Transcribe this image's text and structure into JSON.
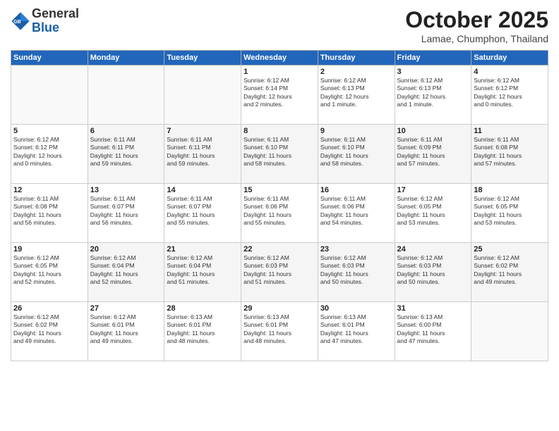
{
  "header": {
    "logo_general": "General",
    "logo_blue": "Blue",
    "month": "October 2025",
    "location": "Lamae, Chumphon, Thailand"
  },
  "weekdays": [
    "Sunday",
    "Monday",
    "Tuesday",
    "Wednesday",
    "Thursday",
    "Friday",
    "Saturday"
  ],
  "weeks": [
    [
      {
        "day": "",
        "info": ""
      },
      {
        "day": "",
        "info": ""
      },
      {
        "day": "",
        "info": ""
      },
      {
        "day": "1",
        "info": "Sunrise: 6:12 AM\nSunset: 6:14 PM\nDaylight: 12 hours\nand 2 minutes."
      },
      {
        "day": "2",
        "info": "Sunrise: 6:12 AM\nSunset: 6:13 PM\nDaylight: 12 hours\nand 1 minute."
      },
      {
        "day": "3",
        "info": "Sunrise: 6:12 AM\nSunset: 6:13 PM\nDaylight: 12 hours\nand 1 minute."
      },
      {
        "day": "4",
        "info": "Sunrise: 6:12 AM\nSunset: 6:12 PM\nDaylight: 12 hours\nand 0 minutes."
      }
    ],
    [
      {
        "day": "5",
        "info": "Sunrise: 6:12 AM\nSunset: 6:12 PM\nDaylight: 12 hours\nand 0 minutes."
      },
      {
        "day": "6",
        "info": "Sunrise: 6:11 AM\nSunset: 6:11 PM\nDaylight: 11 hours\nand 59 minutes."
      },
      {
        "day": "7",
        "info": "Sunrise: 6:11 AM\nSunset: 6:11 PM\nDaylight: 11 hours\nand 59 minutes."
      },
      {
        "day": "8",
        "info": "Sunrise: 6:11 AM\nSunset: 6:10 PM\nDaylight: 11 hours\nand 58 minutes."
      },
      {
        "day": "9",
        "info": "Sunrise: 6:11 AM\nSunset: 6:10 PM\nDaylight: 11 hours\nand 58 minutes."
      },
      {
        "day": "10",
        "info": "Sunrise: 6:11 AM\nSunset: 6:09 PM\nDaylight: 11 hours\nand 57 minutes."
      },
      {
        "day": "11",
        "info": "Sunrise: 6:11 AM\nSunset: 6:08 PM\nDaylight: 11 hours\nand 57 minutes."
      }
    ],
    [
      {
        "day": "12",
        "info": "Sunrise: 6:11 AM\nSunset: 6:08 PM\nDaylight: 11 hours\nand 56 minutes."
      },
      {
        "day": "13",
        "info": "Sunrise: 6:11 AM\nSunset: 6:07 PM\nDaylight: 11 hours\nand 56 minutes."
      },
      {
        "day": "14",
        "info": "Sunrise: 6:11 AM\nSunset: 6:07 PM\nDaylight: 11 hours\nand 55 minutes."
      },
      {
        "day": "15",
        "info": "Sunrise: 6:11 AM\nSunset: 6:06 PM\nDaylight: 11 hours\nand 55 minutes."
      },
      {
        "day": "16",
        "info": "Sunrise: 6:11 AM\nSunset: 6:06 PM\nDaylight: 11 hours\nand 54 minutes."
      },
      {
        "day": "17",
        "info": "Sunrise: 6:12 AM\nSunset: 6:05 PM\nDaylight: 11 hours\nand 53 minutes."
      },
      {
        "day": "18",
        "info": "Sunrise: 6:12 AM\nSunset: 6:05 PM\nDaylight: 11 hours\nand 53 minutes."
      }
    ],
    [
      {
        "day": "19",
        "info": "Sunrise: 6:12 AM\nSunset: 6:05 PM\nDaylight: 11 hours\nand 52 minutes."
      },
      {
        "day": "20",
        "info": "Sunrise: 6:12 AM\nSunset: 6:04 PM\nDaylight: 11 hours\nand 52 minutes."
      },
      {
        "day": "21",
        "info": "Sunrise: 6:12 AM\nSunset: 6:04 PM\nDaylight: 11 hours\nand 51 minutes."
      },
      {
        "day": "22",
        "info": "Sunrise: 6:12 AM\nSunset: 6:03 PM\nDaylight: 11 hours\nand 51 minutes."
      },
      {
        "day": "23",
        "info": "Sunrise: 6:12 AM\nSunset: 6:03 PM\nDaylight: 11 hours\nand 50 minutes."
      },
      {
        "day": "24",
        "info": "Sunrise: 6:12 AM\nSunset: 6:03 PM\nDaylight: 11 hours\nand 50 minutes."
      },
      {
        "day": "25",
        "info": "Sunrise: 6:12 AM\nSunset: 6:02 PM\nDaylight: 11 hours\nand 49 minutes."
      }
    ],
    [
      {
        "day": "26",
        "info": "Sunrise: 6:12 AM\nSunset: 6:02 PM\nDaylight: 11 hours\nand 49 minutes."
      },
      {
        "day": "27",
        "info": "Sunrise: 6:12 AM\nSunset: 6:01 PM\nDaylight: 11 hours\nand 49 minutes."
      },
      {
        "day": "28",
        "info": "Sunrise: 6:13 AM\nSunset: 6:01 PM\nDaylight: 11 hours\nand 48 minutes."
      },
      {
        "day": "29",
        "info": "Sunrise: 6:13 AM\nSunset: 6:01 PM\nDaylight: 11 hours\nand 48 minutes."
      },
      {
        "day": "30",
        "info": "Sunrise: 6:13 AM\nSunset: 6:01 PM\nDaylight: 11 hours\nand 47 minutes."
      },
      {
        "day": "31",
        "info": "Sunrise: 6:13 AM\nSunset: 6:00 PM\nDaylight: 11 hours\nand 47 minutes."
      },
      {
        "day": "",
        "info": ""
      }
    ]
  ]
}
